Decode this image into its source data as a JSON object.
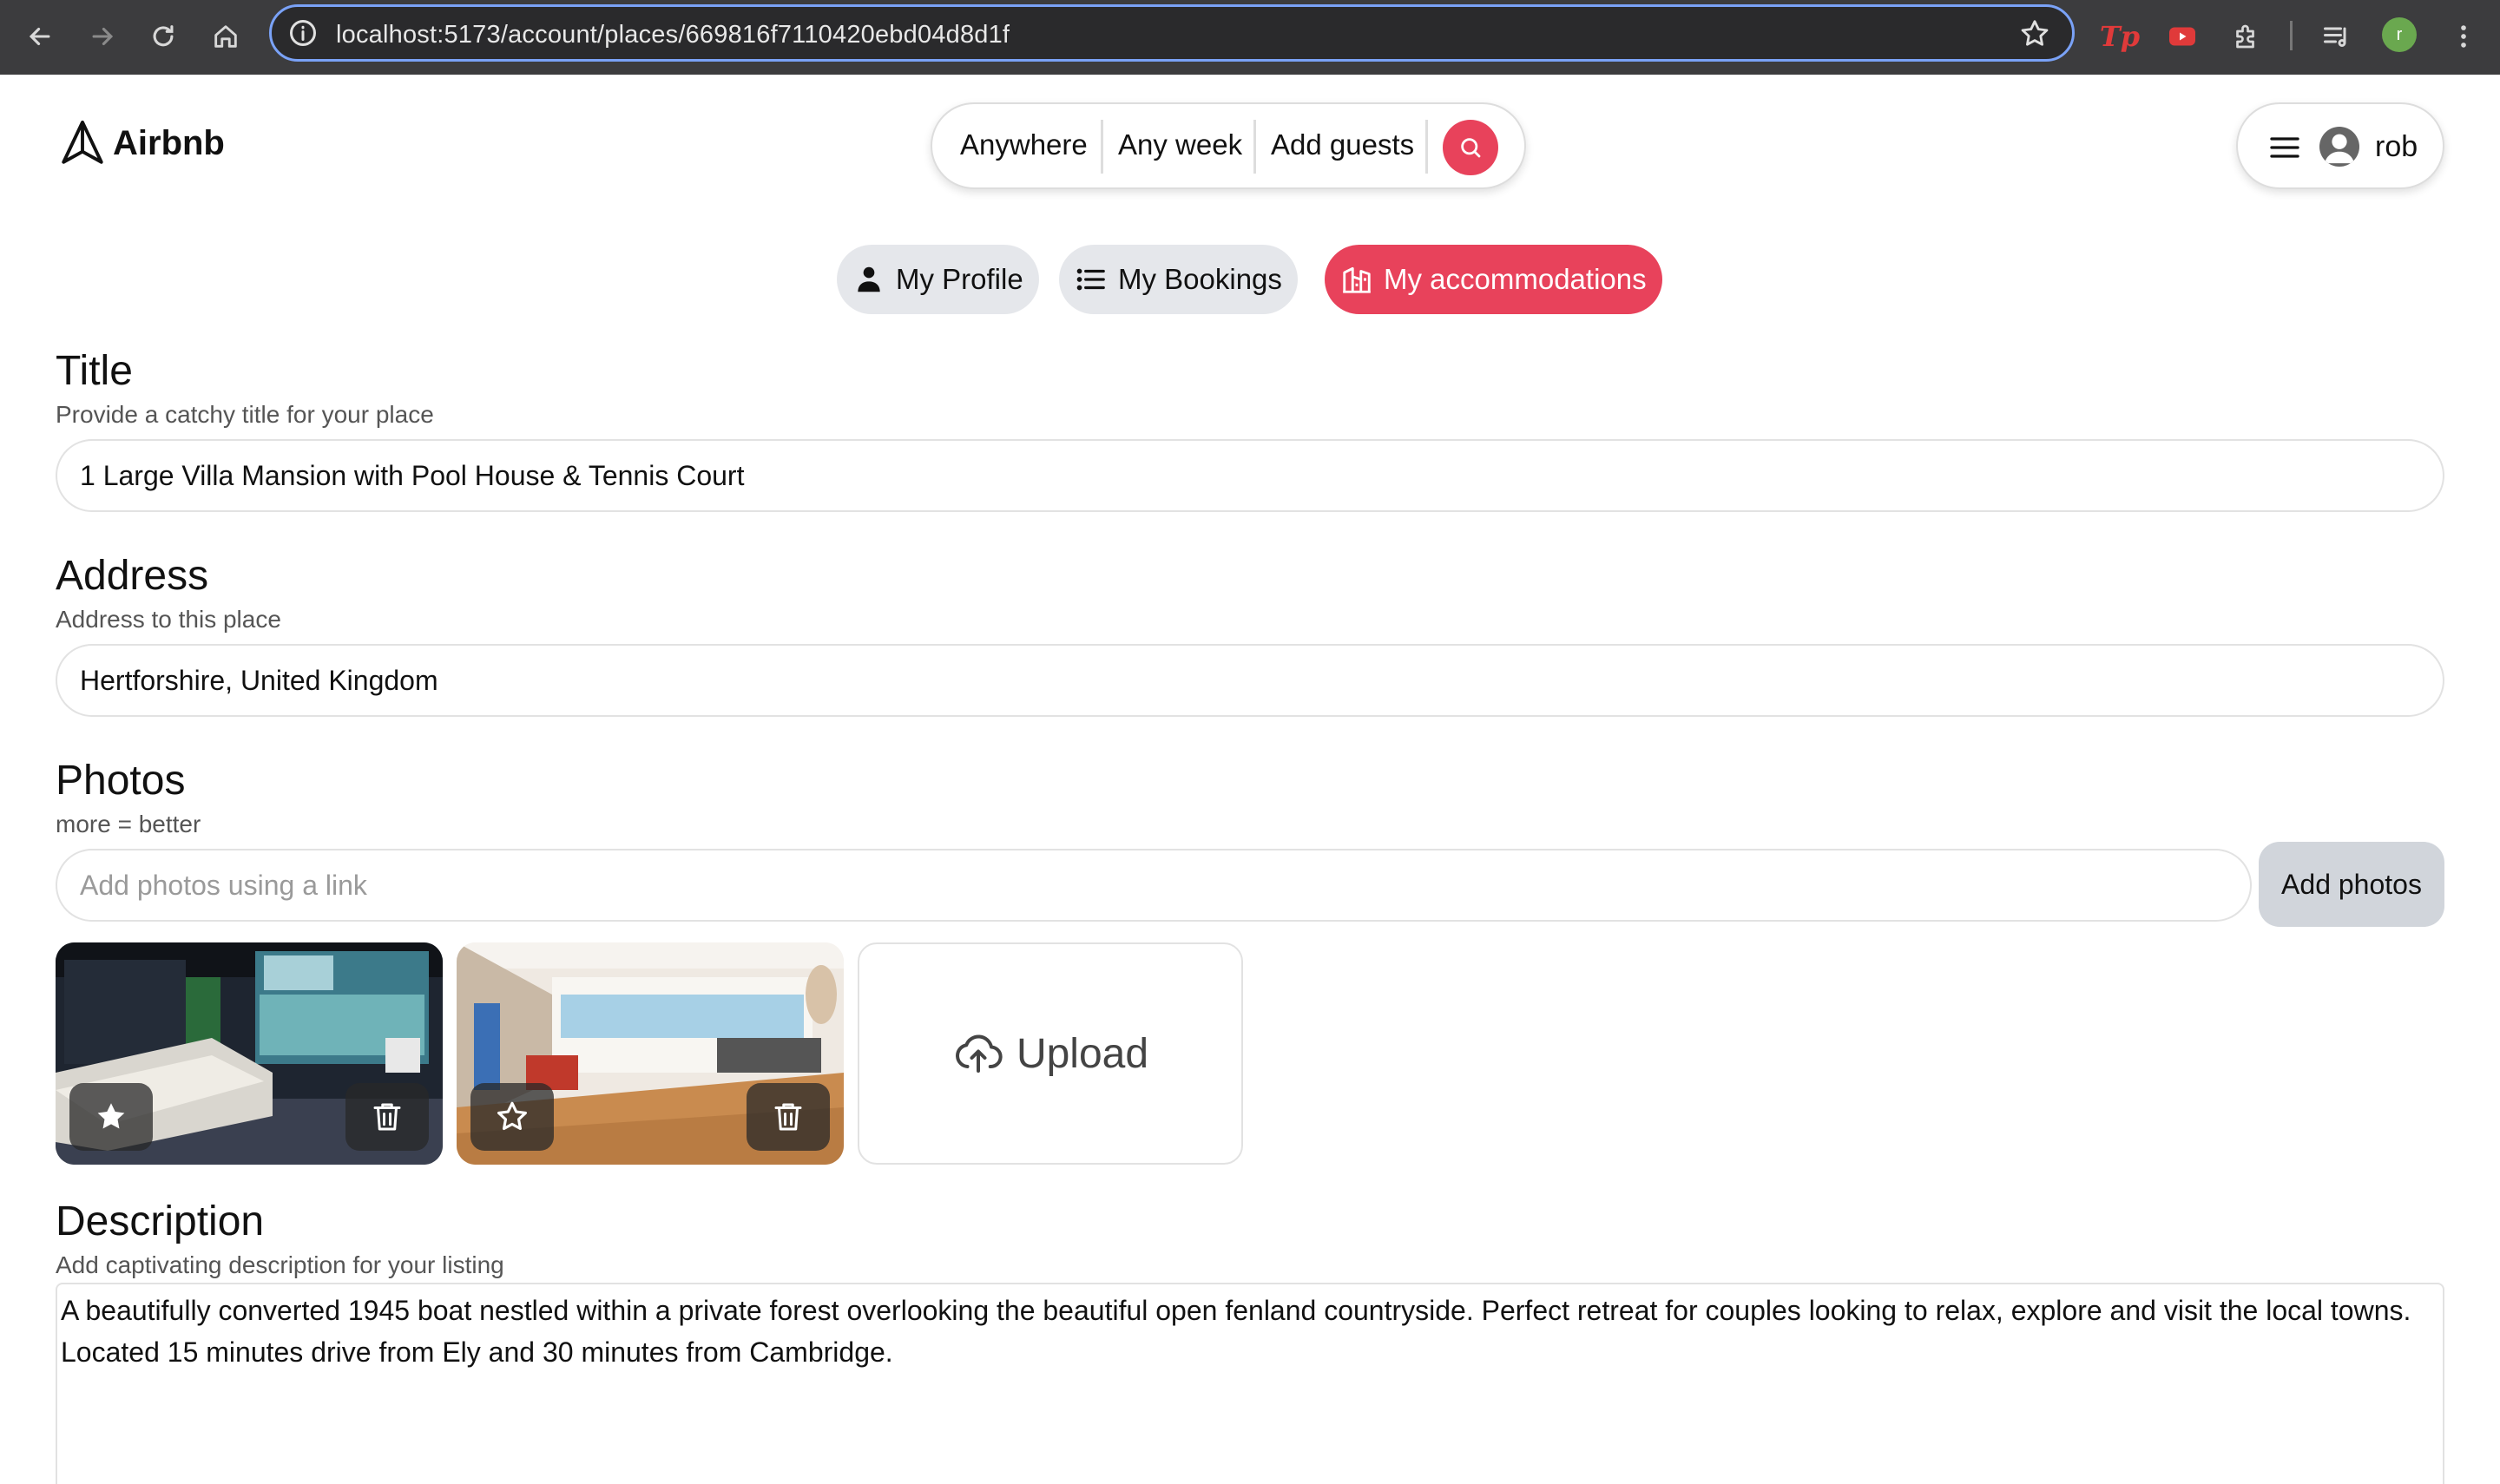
{
  "browser": {
    "url": "localhost:5173/account/places/669816f7110420ebd04d8d1f",
    "profile_initial": "r",
    "extension_tp": "Tp",
    "icons": [
      "back-icon",
      "forward-icon",
      "reload-icon",
      "home-icon",
      "info-icon",
      "bookmark-star-icon",
      "youtube-icon",
      "puzzle-icon",
      "media-icon",
      "kebab-menu-icon"
    ]
  },
  "header": {
    "logo_text": "Airbnb",
    "search": {
      "anywhere": "Anywhere",
      "any_week": "Any week",
      "add_guests": "Add guests"
    },
    "user": {
      "name": "rob"
    }
  },
  "tabs": [
    {
      "label": "My Profile",
      "icon": "person-icon",
      "active": false
    },
    {
      "label": "My Bookings",
      "icon": "list-icon",
      "active": false
    },
    {
      "label": "My accommodations",
      "icon": "building-icon",
      "active": true
    }
  ],
  "form": {
    "title": {
      "heading": "Title",
      "hint": "Provide a catchy title for your place",
      "value": "1 Large Villa Mansion with Pool House & Tennis Court"
    },
    "address": {
      "heading": "Address",
      "hint": "Address to this place",
      "value": "Hertforshire, United Kingdom"
    },
    "photos": {
      "heading": "Photos",
      "hint": "more = better",
      "placeholder": "Add photos using a link",
      "add_button": "Add photos",
      "upload_label": "Upload",
      "items": [
        {
          "name": "home-cinema-photo",
          "is_main": true
        },
        {
          "name": "home-gym-photo",
          "is_main": false
        }
      ]
    },
    "description": {
      "heading": "Description",
      "hint": "Add captivating description for your listing",
      "value": "A beautifully converted 1945 boat nestled within a private forest overlooking the beautiful open fenland countryside. Perfect retreat for couples looking to relax, explore and visit the local towns. Located 15 minutes drive from Ely and 30 minutes from Cambridge."
    }
  },
  "colors": {
    "accent": "#e8425b",
    "chrome_bg": "#3c3c3e",
    "tab_bg": "#e5e7eb",
    "button_gray": "#d1d5db"
  }
}
